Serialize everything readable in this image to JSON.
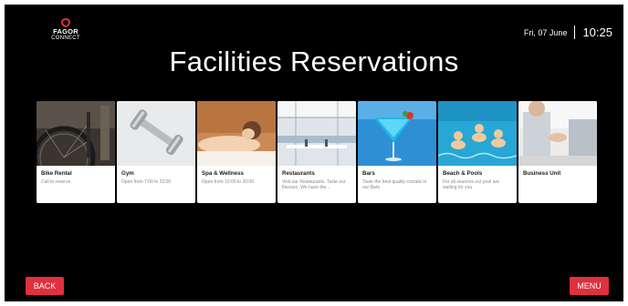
{
  "brand": {
    "name": "FAGOR",
    "sub": "CONNECT",
    "accent": "#e0303d"
  },
  "clock": {
    "date": "Fri, 07 June",
    "time": "10:25"
  },
  "page_title": "Facilities Reservations",
  "cards": [
    {
      "name": "Bike Rental",
      "desc": "Call to reserve",
      "image": "bicycle-wheel"
    },
    {
      "name": "Gym",
      "desc": "Open from 7:00 to 22:00",
      "image": "dumbbells"
    },
    {
      "name": "Spa & Wellness",
      "desc": "Open from 10:00 to 20:00",
      "image": "spa-massage"
    },
    {
      "name": "Restaurants",
      "desc": "Visit our Restaurants. Taste our flavours. We have the...",
      "image": "restaurant-terrace"
    },
    {
      "name": "Bars",
      "desc": "Taste the best quality coctails in our Bars",
      "image": "cocktail"
    },
    {
      "name": "Beach & Pools",
      "desc": "For all seasons our pool are waiting for you",
      "image": "pool-swimmers"
    },
    {
      "name": "Business Unit",
      "desc": "",
      "image": "business-handshake"
    }
  ],
  "buttons": {
    "back": "BACK",
    "menu": "MENU"
  }
}
